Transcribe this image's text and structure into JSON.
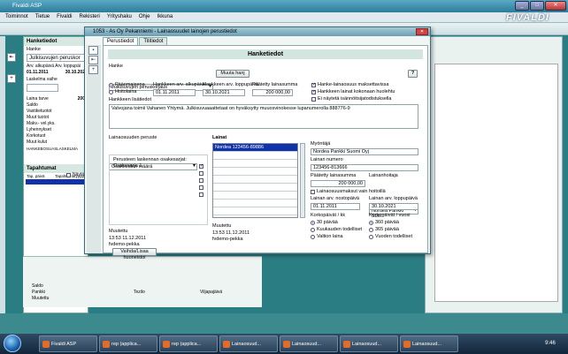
{
  "app": {
    "title": "Fivaldi ASP",
    "logo": "FIVALDI",
    "menu": [
      "Toiminnot",
      "Tietue",
      "Fivaldi",
      "Rekisteri",
      "Yrityshaku",
      "Ohje",
      "Ikkuna"
    ]
  },
  "bg_window": {
    "header": "Hanketiedot",
    "sub": "Hanke",
    "field_value": "Julkisuvujen peruskor",
    "dates_label": "Arv. alkupäivä Arv. loppupäi",
    "date_start": "01.11.2011",
    "date_end": "30.10.202",
    "laskelma_label": "Laskelma vaihe",
    "rows": [
      {
        "label": "Laina tarve",
        "value": "200"
      },
      {
        "label": "Saldo",
        "value": ""
      },
      {
        "label": "Vastiketuotot",
        "value": ""
      },
      {
        "label": "Muut tuotot",
        "value": ""
      },
      {
        "label": "Makv.- vel.yks.",
        "value": ""
      },
      {
        "label": "Lyhennykset",
        "value": ""
      },
      {
        "label": "Korkotuot",
        "value": ""
      },
      {
        "label": "Muut kulut",
        "value": ""
      }
    ],
    "footer": "HANKEBOSUASLASKELMA",
    "tapahtumat": "Tapahtumat",
    "tapahtumat_check": "Näytä",
    "col1": "Tap. päivä",
    "col2": "Tapahtumatyyppi",
    "bottom_labels": [
      "Saldo",
      "Pankki",
      "Muutettu"
    ],
    "bottom_mid": "Tezilo",
    "bottom_right": "Viljapajäivä"
  },
  "dialog": {
    "title": "1053 - As Oy Pekanniemi - Lainaosuudet lainojen perustiedot",
    "tabs": [
      "Perustiedot",
      "Tilitiedot"
    ],
    "section_title": "Hanketiedot",
    "hanke_label": "Hanke",
    "hanke_value": "Julkisuvujen peruskorjaus",
    "muuta_hanke": "Muuta hanj",
    "help": "?",
    "radio_paakomaisena": "Pääomaisena",
    "radio_hoitolaina": "Hoitolaina",
    "lbl_alkupaiva": "Hankkeen arv. alkupäivä",
    "val_alkupaiva": "01.11.2011",
    "lbl_loppupaiva": "Hankkeen arv. loppupäivä",
    "val_loppupaiva": "30.10.2021",
    "lbl_lainamaara": "Päätetty lainasumma",
    "val_lainamaara": "200 000,00",
    "chk_maksettavissa": "Hanke-lainaosuus maksettavissa",
    "chk_kokonaan": "Hankkeen lainat kokonaan huolehtu",
    "chk_naytetaan": "Ei näytetä isännöitsijatodistuksella",
    "lbl_lisatiedot": "Hankkeen lisätiedot",
    "lisatiedot": "Valvojana toimii Vahanen Yhtymä. Julkisuvuaaattetaat on hyväksytty muuosvinokesse lupanumerolla 888776-9",
    "lbl_peruste": "Lainaosuuden peruste",
    "peruste_value": "Osakkeiden määrä",
    "lbl_lasketaan": "Perusteen laskennan osakesarjat:",
    "osakesarja": "Osakesarja 1",
    "checkboxes": [
      true,
      false,
      false,
      false,
      false
    ],
    "lbl_muutettu": "Muutettu",
    "muutettu_1": "13:53 11.12.2011",
    "muutettu_2": "fvdemo-pekka",
    "btn_vaihda": "Vaihda/Lisaa huoneistoi",
    "lainat_header": "Lainat",
    "lainat_rows": [
      "Nordea 123456-89886",
      "",
      "",
      "",
      "",
      "",
      "",
      "",
      ""
    ],
    "lbl_muutettu_mid": "Muutettu",
    "muutettu_mid_1": "13:53 11.12.2011",
    "muutettu_mid_2": "fvdemo-pekka",
    "lbl_myontaja": "Myöntäjä",
    "myontaja": "Nordea Pankki Suomi Oyj",
    "lbl_lainanumero": "Lainan numero",
    "lainanumero": "123456-813666",
    "lbl_paatetty": "Päätetty lainasumma",
    "paatetty": "200 000,00",
    "lbl_lainanhoitaja": "Lainanhoitaja",
    "lainanhoitaja": "Nordea Pankki Suo...",
    "chk_hoitolaina": "Lainaosuusmaksut vain hoitoillä",
    "lbl_nostopaiva": "Lainan arv. nostopäivä",
    "nostopaiva": "01.11.2011",
    "lbl_loppupv": "Lainan arv. loppupäivä",
    "loppupv": "30.10.2021",
    "lbl_korkopaivat": "Korkopäivät / kk",
    "korko_opts": [
      "30 päivää",
      "Kuukauden todelliset",
      "Valtion laina"
    ],
    "lbl_korkovuosi": "Korkopäivät / vuosi",
    "korko_vuosi_opts": [
      "360 päivää",
      "365 päivää",
      "Vuoden todelliset"
    ]
  },
  "taskbar": {
    "items": [
      "Fivaldi ASP",
      "rep (applica...",
      "rep (applica...",
      "Lainaosuud...",
      "Lainaosuud...",
      "Lainaosuud...",
      "Lainaosuud..."
    ],
    "clock": "9:46"
  }
}
